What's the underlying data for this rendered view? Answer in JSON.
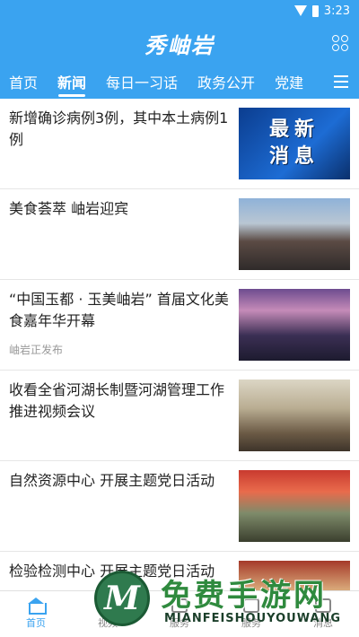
{
  "status_bar": {
    "time": "3:23"
  },
  "header": {
    "title": "秀岫岩"
  },
  "tabs": [
    {
      "label": "首页",
      "active": false
    },
    {
      "label": "新闻",
      "active": true
    },
    {
      "label": "每日一习话",
      "active": false
    },
    {
      "label": "政务公开",
      "active": false
    },
    {
      "label": "党建",
      "active": false
    }
  ],
  "news": [
    {
      "title": "新增确诊病例3例，其中本土病例1例",
      "source": "",
      "thumb_text": [
        "最新",
        "消息"
      ]
    },
    {
      "title": "美食荟萃  岫岩迎宾",
      "source": ""
    },
    {
      "title": "“中国玉都 · 玉美岫岩” 首届文化美食嘉年华开幕",
      "source": "岫岩正发布"
    },
    {
      "title": "收看全省河湖长制暨河湖管理工作推进视频会议",
      "source": ""
    },
    {
      "title": "自然资源中心  开展主题党日活动",
      "source": ""
    },
    {
      "title": "检验检测中心  开展主题党日活动",
      "source": ""
    }
  ],
  "bottom_nav": [
    {
      "label": "首页",
      "active": true
    },
    {
      "label": "视频",
      "active": false
    },
    {
      "label": "服务",
      "active": false
    },
    {
      "label": "服务",
      "active": false
    },
    {
      "label": "消息",
      "active": false
    }
  ],
  "watermark": {
    "logo_letter": "M",
    "title": "免费手游网",
    "subtitle": "MIANFEISHOUYOUWANG"
  },
  "colors": {
    "primary": "#3aa3f0",
    "text": "#222222",
    "muted": "#999999"
  }
}
